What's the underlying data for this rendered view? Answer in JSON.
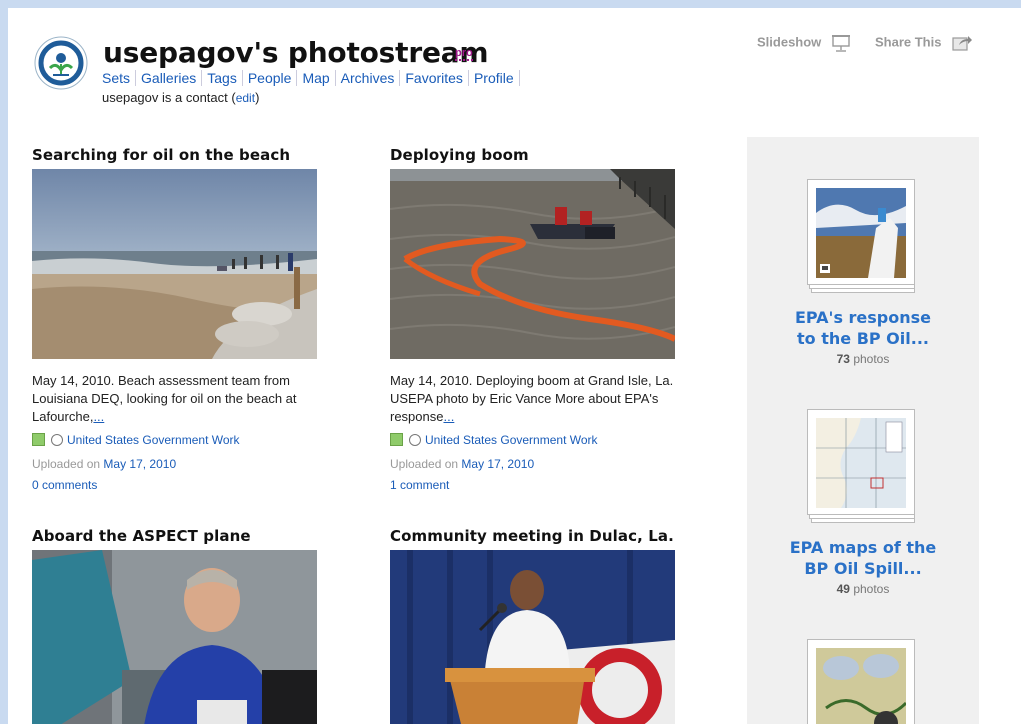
{
  "header": {
    "title": "usepagov's photostream",
    "pro_badge": "pro",
    "nav": [
      "Sets",
      "Galleries",
      "Tags",
      "People",
      "Map",
      "Archives",
      "Favorites",
      "Profile"
    ],
    "contact_text": "usepagov is a contact",
    "edit_label": "edit",
    "slideshow_label": "Slideshow",
    "share_label": "Share This"
  },
  "photos": [
    {
      "title": "Searching for oil on the beach",
      "description": "May 14, 2010. Beach assessment team from Louisiana DEQ, looking for oil on the beach at Lafourche,",
      "more": "...",
      "license": "United States Government Work",
      "uploaded_prefix": "Uploaded on",
      "uploaded_date": "May 17, 2010",
      "comments": "0 comments"
    },
    {
      "title": "Deploying boom",
      "description": "May 14, 2010. Deploying boom at Grand Isle, La. USEPA photo by Eric Vance More about EPA's response",
      "more": "...",
      "license": "United States Government Work",
      "uploaded_prefix": "Uploaded on",
      "uploaded_date": "May 17, 2010",
      "comments": "1 comment"
    },
    {
      "title": "Aboard the ASPECT plane"
    },
    {
      "title": "Community meeting in Dulac, La."
    }
  ],
  "sets": [
    {
      "name_line1": "EPA's response",
      "name_line2": "to the BP Oil...",
      "count": "73",
      "count_label": "photos"
    },
    {
      "name_line1": "EPA maps of the",
      "name_line2": "BP Oil Spill...",
      "count": "49",
      "count_label": "photos"
    }
  ],
  "colors": {
    "link": "#1a5cb8",
    "set_title": "#2a71c7",
    "pro": "#a0198c",
    "sidebar_bg": "#f0f0f0",
    "outer_bg": "#c9daf0"
  }
}
